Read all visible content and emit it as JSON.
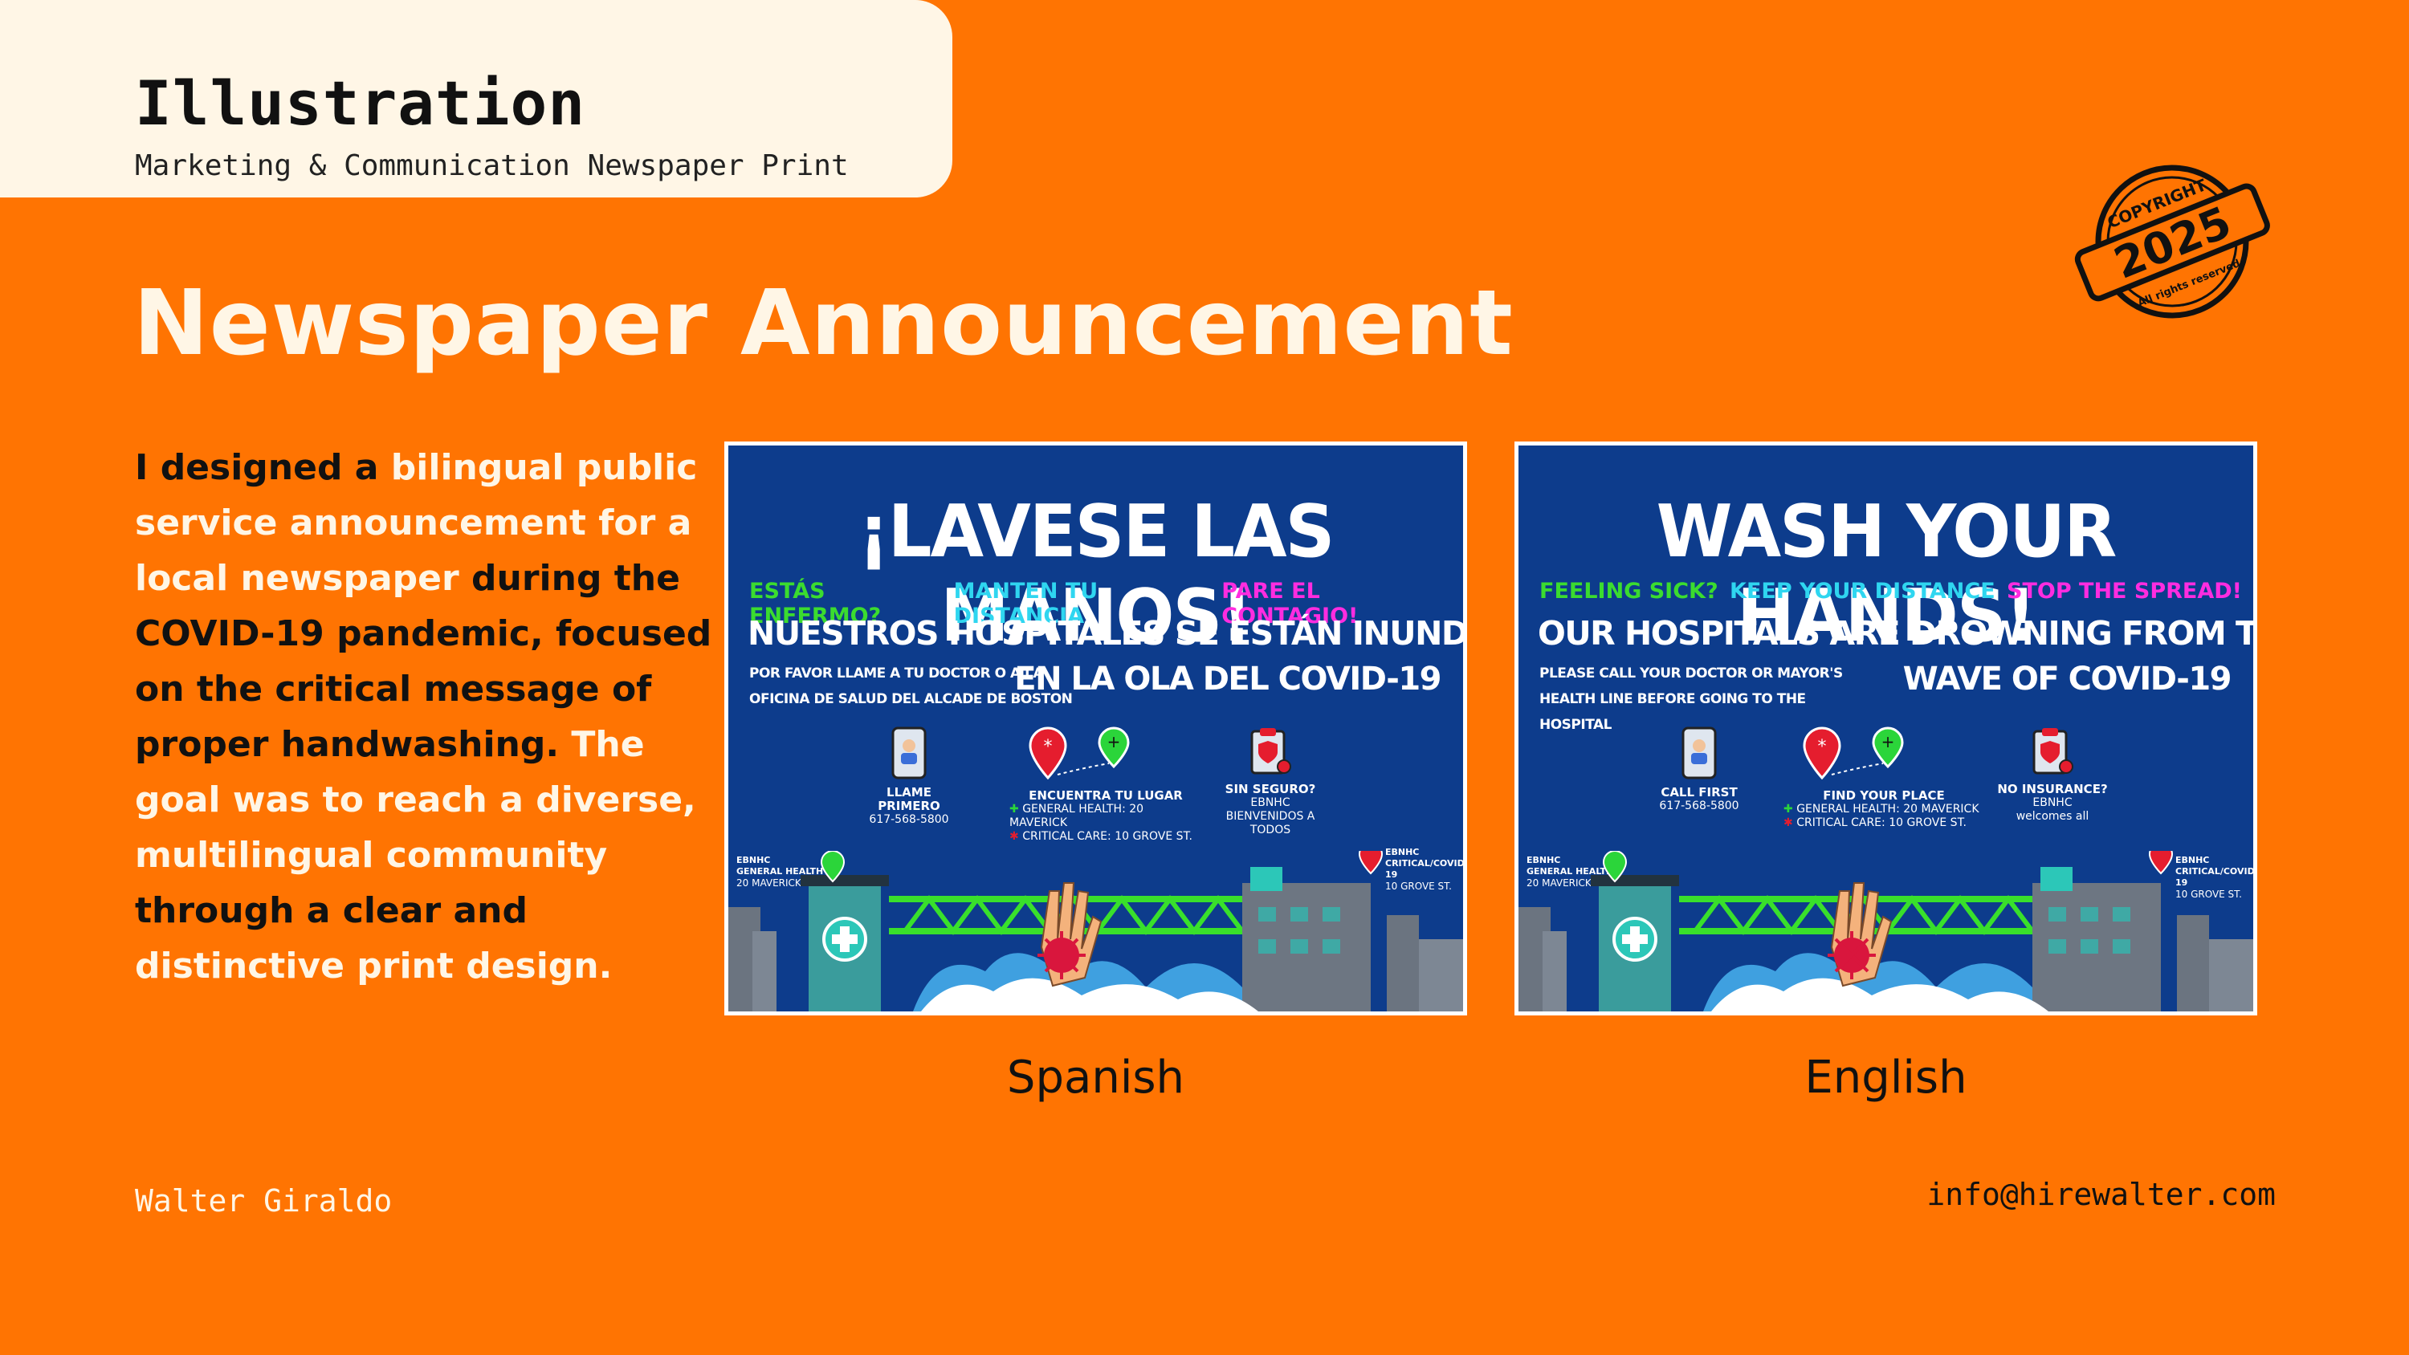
{
  "header": {
    "title": "Illustration",
    "subtitle": "Marketing & Communication Newspaper Print"
  },
  "headline": "Newspaper Announcement",
  "description": [
    {
      "text": "I designed a ",
      "highlight": false
    },
    {
      "text": "bilingual public service announcement for a local newspaper",
      "highlight": true
    },
    {
      "text": " during the COVID-19 pandemic, focused on the critical message of proper handwashing.",
      "highlight": false
    },
    {
      "text": " The goal was to reach a diverse, multilingual community",
      "highlight": true
    },
    {
      "text": " through a clear and",
      "highlight": false
    },
    {
      "text": " distinctive print design.",
      "highlight": true
    }
  ],
  "stamp": {
    "top": "COPYRIGHT",
    "year": "2025",
    "bottom": "All rights reserved"
  },
  "posters": {
    "spanish": {
      "caption": "Spanish",
      "headline": "¡LAVESE LAS MANOS!",
      "tag1": "ESTÁS ENFERMO?",
      "tag2": "MANTEN TU DISTANCIA",
      "tag3": "PARE EL CONTAGIO!",
      "big1": "NUESTROS HOSPITALES SE ESTÁN INUNDANDO",
      "small": "POR FAVOR LLAME A TU DOCTOR O A LA OFICINA DE SALUD DEL ALCADE DE BOSTON",
      "big2": "EN LA OLA DEL COVID-19",
      "call_title": "LLAME PRIMERO",
      "call_phone": "617-568-5800",
      "find_title": "ENCUENTRA TU LUGAR",
      "find_line1": "GENERAL HEALTH: 20 MAVERICK",
      "find_line2": "CRITICAL CARE: 10 GROVE ST.",
      "ins_title": "SIN SEGURO?",
      "ins_line1": "EBNHC",
      "ins_line2": "BIENVENIDOS A TODOS",
      "left_label_1": "EBNHC",
      "left_label_2": "GENERAL HEALTH",
      "left_label_3": "20 MAVERICK",
      "right_label_1": "EBNHC",
      "right_label_2": "CRITICAL/COVID-19",
      "right_label_3": "10 GROVE ST."
    },
    "english": {
      "caption": "English",
      "headline": "WASH YOUR HANDS!",
      "tag1": "FEELING SICK?",
      "tag2": "KEEP YOUR DISTANCE",
      "tag3": "STOP THE SPREAD!",
      "big1": "OUR HOSPITALS ARE DROWNING  FROM THE",
      "small": "PLEASE CALL YOUR DOCTOR OR MAYOR'S HEALTH LINE BEFORE GOING TO THE HOSPITAL",
      "big2": "WAVE OF COVID-19",
      "call_title": "CALL FIRST",
      "call_phone": "617-568-5800",
      "find_title": "FIND YOUR PLACE",
      "find_line1": "GENERAL HEALTH: 20 MAVERICK",
      "find_line2": "CRITICAL CARE: 10 GROVE ST.",
      "ins_title": "NO INSURANCE?",
      "ins_line1": "EBNHC",
      "ins_line2": "welcomes all",
      "left_label_1": "EBNHC",
      "left_label_2": "GENERAL HEALTH",
      "left_label_3": "20 MAVERICK",
      "right_label_1": "EBNHC",
      "right_label_2": "CRITICAL/COVID-19",
      "right_label_3": "10 GROVE ST."
    }
  },
  "footer": {
    "author": "Walter Giraldo",
    "email": "info@hirewalter.com"
  },
  "colors": {
    "background": "#ff7402",
    "cream": "#fff6e6",
    "poster_blue": "#0d3c8c",
    "bridge_green": "#39e02b"
  }
}
